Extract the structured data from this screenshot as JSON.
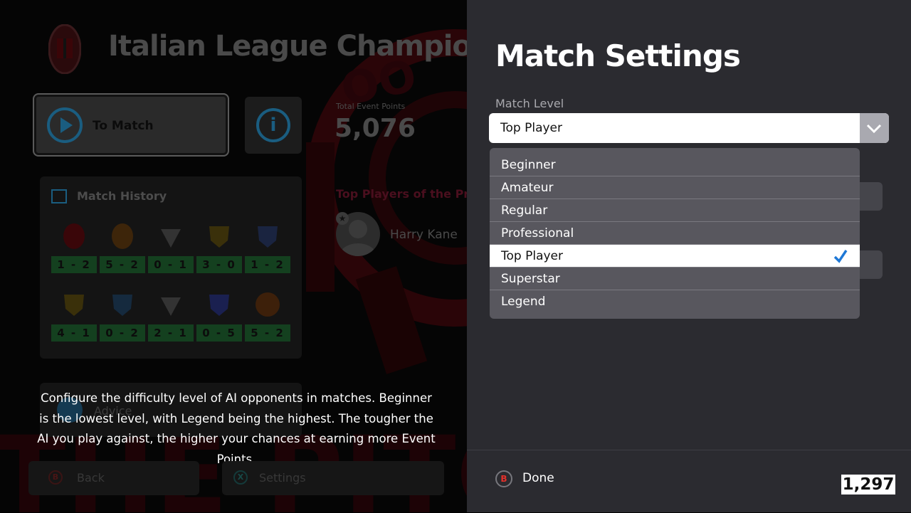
{
  "background_screen": {
    "event_title": "Italian League Champions",
    "to_match_label": "To Match",
    "total_points_label": "Total Event Points",
    "total_points_value": "5,076",
    "match_history": {
      "title": "Match History",
      "results": [
        {
          "score": "1 - 2",
          "crest_color": "#5a0a10"
        },
        {
          "score": "5 - 2",
          "crest_color": "#5a3a10"
        },
        {
          "score": "0 - 1",
          "crest_color": "#3a3a3a"
        },
        {
          "score": "3 - 0",
          "crest_color": "#4a3a0a"
        },
        {
          "score": "1 - 2",
          "crest_color": "#1a2a4a"
        },
        {
          "score": "4 - 1",
          "crest_color": "#4a3a0a"
        },
        {
          "score": "0 - 2",
          "crest_color": "#1a3a5a"
        },
        {
          "score": "2 - 1",
          "crest_color": "#3a3a3a"
        },
        {
          "score": "0 - 5",
          "crest_color": "#1a2a6a"
        },
        {
          "score": "5 - 2",
          "crest_color": "#5a2a10"
        }
      ]
    },
    "top_players_title": "Top Players of the Previ",
    "top_player_name": "Harry Kane",
    "advice_label": "Advice",
    "back_pad": "B",
    "back_label": "Back",
    "settings_pad": "X",
    "settings_label": "Settings"
  },
  "description": "Configure the difficulty level of AI opponents in matches. Beginner is the lowest level, with Legend being the highest. The tougher the AI you play against, the higher your chances at earning more Event Points.",
  "settings_panel": {
    "title": "Match Settings",
    "field_label": "Match Level",
    "selected_value": "Top Player",
    "options": [
      {
        "label": "Beginner",
        "selected": false
      },
      {
        "label": "Amateur",
        "selected": false
      },
      {
        "label": "Regular",
        "selected": false
      },
      {
        "label": "Professional",
        "selected": false
      },
      {
        "label": "Top Player",
        "selected": true
      },
      {
        "label": "Superstar",
        "selected": false
      },
      {
        "label": "Legend",
        "selected": false
      }
    ],
    "check_icon": "checkmark-icon",
    "accent_color": "#1e78d6"
  },
  "footer": {
    "done_pad": "B",
    "done_label": "Done",
    "coins": "1,297"
  }
}
